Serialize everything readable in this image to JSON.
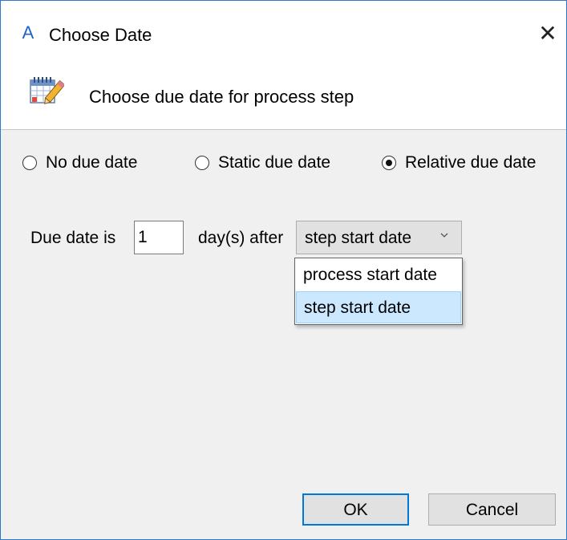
{
  "window": {
    "app_icon_glyph": "A",
    "title": "Choose Date",
    "close_glyph": "✕"
  },
  "header": {
    "icon": "calendar-edit-icon",
    "text": "Choose due date for process step"
  },
  "due_type": {
    "options": [
      {
        "label": "No due date",
        "selected": false
      },
      {
        "label": "Static due date",
        "selected": false
      },
      {
        "label": "Relative due date",
        "selected": true
      }
    ]
  },
  "relative": {
    "prefix_label": "Due date is",
    "days_value": "1",
    "after_label": "day(s) after",
    "selected_value": "step start date",
    "dropdown_options": [
      "process start date",
      "step start date"
    ],
    "highlighted_option": "step start date"
  },
  "buttons": {
    "ok_label": "OK",
    "cancel_label": "Cancel"
  },
  "colors": {
    "accent": "#0078d7",
    "window_border": "#2b79c7",
    "selection_bg": "#cce8ff"
  }
}
